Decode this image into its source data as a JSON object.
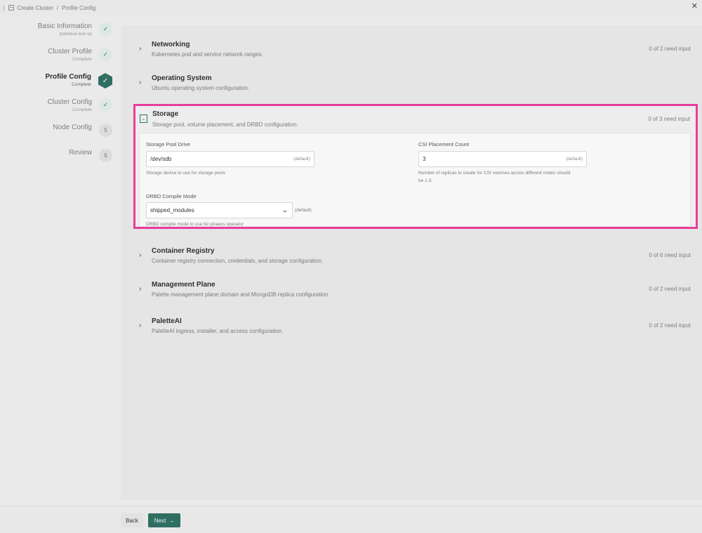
{
  "breadcrumb": {
    "root": "Create Cluster",
    "separator": "/",
    "current": "Profile Config"
  },
  "stepper": [
    {
      "name": "Basic Information",
      "sub": "paletteai-test-sp",
      "state": "done",
      "badge": "✓"
    },
    {
      "name": "Cluster Profile",
      "sub": "Complete",
      "state": "done",
      "badge": "✓"
    },
    {
      "name": "Profile Config",
      "sub": "Complete",
      "state": "current",
      "badge": "✓"
    },
    {
      "name": "Cluster Config",
      "sub": "Complete",
      "state": "done",
      "badge": "✓"
    },
    {
      "name": "Node Config",
      "sub": "",
      "state": "todo",
      "badge": "5"
    },
    {
      "name": "Review",
      "sub": "",
      "state": "todo",
      "badge": "6"
    }
  ],
  "sections": {
    "networking": {
      "title": "Networking",
      "desc": "Kubernetes pod and service network ranges.",
      "count": "0 of 2 need input"
    },
    "os": {
      "title": "Operating System",
      "desc": "Ubuntu operating system configuration.",
      "count": ""
    },
    "storage": {
      "title": "Storage",
      "desc": "Storage pool, volume placement, and DRBD configuration.",
      "count": "0 of 3 need input"
    },
    "registry": {
      "title": "Container Registry",
      "desc": "Container registry connection, credentials, and storage configuration.",
      "count": "0 of 6 need input"
    },
    "mgmt": {
      "title": "Management Plane",
      "desc": "Palette management plane domain and MongoDB replica configuration.",
      "count": "0 of 2 need input"
    },
    "paletteai": {
      "title": "PaletteAI",
      "desc": "PaletteAI ingress, installer, and access configuration.",
      "count": "0 of 2 need input"
    }
  },
  "storage_fields": {
    "pool_drive": {
      "label": "Storage Pool Drive",
      "value": "/dev/sdb",
      "tag": "(default)",
      "helper": "Storage device to use for storage pools"
    },
    "csi_count": {
      "label": "CSI Placement Count",
      "value": "3",
      "tag": "(default)",
      "helper_1": "Number of replicas to create for CSI volumes across different nodes should",
      "helper_2": "be 1-3."
    },
    "drbd_mode": {
      "label": "DRBD Compile Mode",
      "value": "shipped_modules",
      "tag": "(default)",
      "helper": "DRBD compile mode to use for piraeus operator"
    }
  },
  "footer": {
    "back": "Back",
    "next": "Next",
    "next_arrow": "→"
  },
  "icons": {
    "chevron_right": "›",
    "chevron_down": "⌄",
    "close": "✕",
    "caret": "⌄"
  },
  "colors": {
    "accent": "#2f6f62",
    "highlight": "#e83e9b"
  }
}
